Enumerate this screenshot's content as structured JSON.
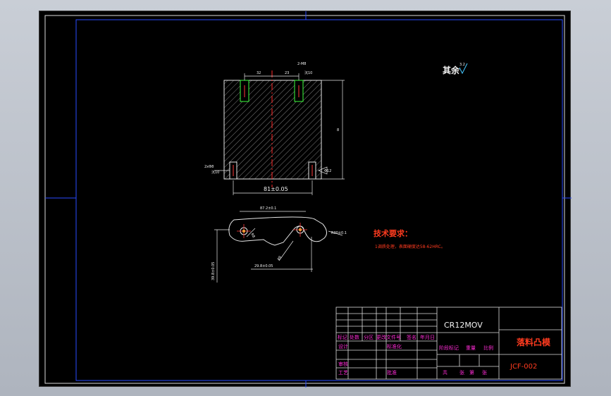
{
  "drawing": {
    "roughness_note": {
      "label": "其余",
      "value": "3.2"
    },
    "tech_requirements": {
      "title": "技术要求：",
      "line": "1调质处理，表面硬度达58-62HRC。"
    },
    "dimensions": {
      "top_left": "32",
      "top_mid": "23",
      "top_right_a": "2-M8",
      "top_right_b": "沉10",
      "right_height": "8",
      "bottom_width": "81±0.05",
      "left_hole_a": "2xΦ8",
      "left_hole_b": "沉10",
      "right_hole": "Φ12",
      "profile_top": "87.2±0.1",
      "profile_left": "39.8±0.05",
      "profile_bottom": "29.8±0.05",
      "profile_r": "R8",
      "profile_diag": "49",
      "profile_radius": "R30±0.1"
    },
    "title_block": {
      "material": "CR12MOV",
      "part_name": "落料凸模",
      "drawing_no": "JCF-002",
      "row_labels": [
        "标记",
        "处数",
        "分区",
        "更改文件号",
        "签名",
        "年月日"
      ],
      "design": "设计",
      "standardize": "标准化",
      "stage_labels": [
        "阶段标记",
        "重量",
        "比例"
      ],
      "review": "审核",
      "process": "工艺",
      "approve": "批准",
      "sheets": [
        "共",
        "张",
        "第",
        "张"
      ]
    }
  }
}
